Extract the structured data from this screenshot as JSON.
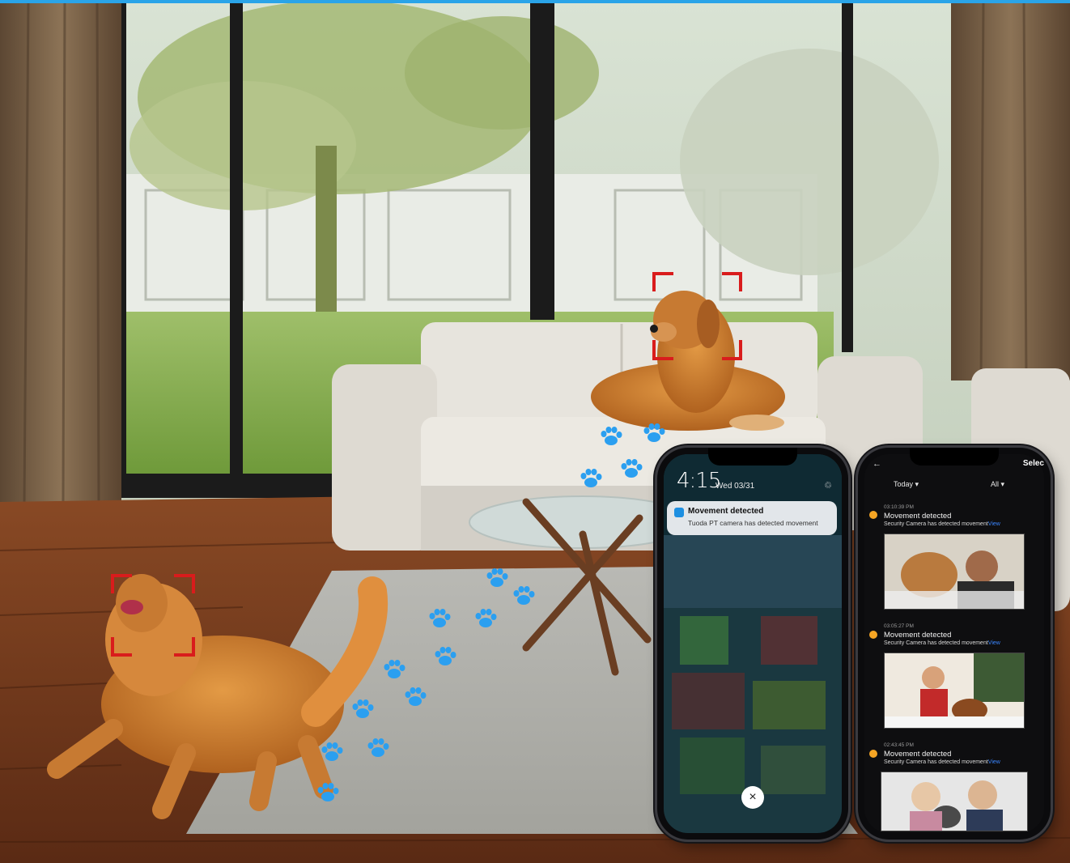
{
  "lock_screen": {
    "time": "4:15",
    "date": "Wed 03/31",
    "notification": {
      "title": "Movement detected",
      "body": "Tuoda PT camera has detected movement"
    },
    "close_glyph": "×"
  },
  "app_screen": {
    "header_action": "Selec",
    "filter_date": "Today ▾",
    "filter_type": "All ▾",
    "events": [
      {
        "time": "03:10:39 PM",
        "title": "Movement detected",
        "desc": "Security Camera has detected movement",
        "link": "View"
      },
      {
        "time": "03:05:27 PM",
        "title": "Movement detected",
        "desc": "Security Camera has detected movement",
        "link": "View"
      },
      {
        "time": "02:43:45 PM",
        "title": "Movement detected",
        "desc": "Security Camera has detected movement",
        "link": "View"
      }
    ]
  },
  "colors": {
    "detection_box": "#d91c1c",
    "paw_print": "#2b9ff0",
    "accent_bar": "#2aa4e8",
    "event_dot": "#f5a524",
    "link": "#3b86ff"
  }
}
